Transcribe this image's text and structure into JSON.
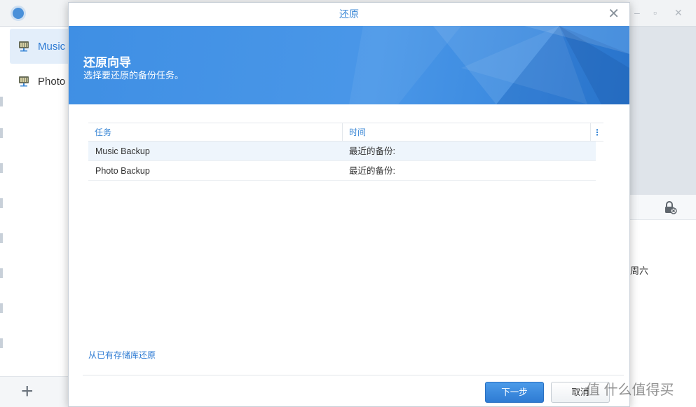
{
  "app": {
    "window_controls": [
      "–",
      "▫",
      "✕"
    ],
    "sidebar": {
      "items": [
        {
          "label": "Music",
          "icon": "nas-server-icon",
          "active": true
        },
        {
          "label": "Photo",
          "icon": "nas-server-icon",
          "active": false
        }
      ],
      "add_label": "+"
    },
    "right_panel": {
      "weekday": "周六",
      "icon": "lock-icon"
    }
  },
  "dialog": {
    "title": "还原",
    "close_label": "✕",
    "banner": {
      "title": "还原向导",
      "subtitle": "选择要还原的备份任务。",
      "color": "#4a97e8"
    },
    "table": {
      "columns": [
        "任务",
        "时间"
      ],
      "menu_label": "⋮",
      "rows": [
        {
          "task": "Music Backup",
          "time": "最近的备份:",
          "selected": true
        },
        {
          "task": "Photo Backup",
          "time": "最近的备份:",
          "selected": false
        }
      ]
    },
    "restore_link": "从已有存储库还原",
    "buttons": {
      "next": "下一步",
      "cancel": "取消"
    }
  },
  "watermark": "值 什么值得买",
  "colors": {
    "accent": "#2e7bd3",
    "header_text": "#3a87d6"
  }
}
